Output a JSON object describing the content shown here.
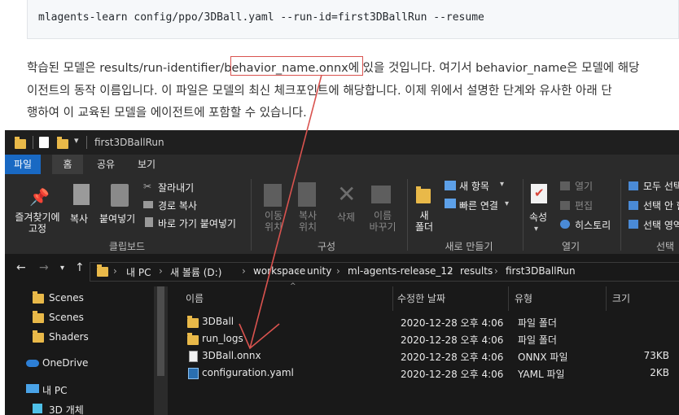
{
  "doc": {
    "command": "mlagents-learn config/ppo/3DBall.yaml --run-id=first3DBallRun --resume",
    "para_line1_a": "학습된 모델은 results/run-identifier",
    "para_line1_hl": "/behavior_name.onnx",
    "para_line1_b": "에 있을 것입니다. 여기서 behavior_name은 모델에 해당",
    "para_line2": "이전트의 동작 이름입니다. 이 파일은 모델의 최신 체크포인트에 해당합니다. 이제 위에서 설명한 단계와 유사한 아래 단",
    "para_line3": "행하여 이 교육된 모델을 에이전트에 포함할 수 있습니다.",
    "annotation_color": "#d9534f"
  },
  "window": {
    "title": "first3DBallRun",
    "tabs": [
      "파일",
      "홈",
      "공유",
      "보기"
    ],
    "ribbon": {
      "pin_label": "즐겨찾기에\n고정",
      "copy": "복사",
      "paste": "붙여넣기",
      "cut": "잘라내기",
      "copy_path": "경로 복사",
      "paste_shortcut": "바로 가기 붙여넣기",
      "move_to": "이동\n위치",
      "copy_to": "복사\n위치",
      "delete": "삭제",
      "rename": "이름\n바꾸기",
      "new_folder": "새\n폴더",
      "new_item": "새 항목",
      "easy_access": "빠른 연결",
      "properties": "속성",
      "open": "열기",
      "edit": "편집",
      "history": "히스토리",
      "select_all": "모두 선택",
      "select_none": "선택 안 함",
      "invert": "선택 영역",
      "groups": [
        "클립보드",
        "구성",
        "새로 만들기",
        "열기",
        "선택"
      ]
    },
    "breadcrumb": [
      "내 PC",
      "새 볼륨 (D:)",
      "workspace",
      "unity",
      "ml-agents-release_12",
      "results",
      "first3DBallRun"
    ],
    "nav_items": [
      "Scenes",
      "Scenes",
      "Shaders",
      "OneDrive",
      "내 PC",
      "3D 개체"
    ],
    "columns": [
      "이름",
      "수정한 날짜",
      "유형",
      "크기"
    ],
    "files": [
      {
        "name": "3DBall",
        "date": "2020-12-28 오후 4:06",
        "type": "파일 폴더",
        "size": "",
        "icon": "folder-icon"
      },
      {
        "name": "run_logs",
        "date": "2020-12-28 오후 4:06",
        "type": "파일 폴더",
        "size": "",
        "icon": "folder-icon"
      },
      {
        "name": "3DBall.onnx",
        "date": "2020-12-28 오후 4:06",
        "type": "ONNX 파일",
        "size": "73KB",
        "icon": "file-icon"
      },
      {
        "name": "configuration.yaml",
        "date": "2020-12-28 오후 4:06",
        "type": "YAML 파일",
        "size": "2KB",
        "icon": "yaml-file-icon"
      }
    ]
  }
}
